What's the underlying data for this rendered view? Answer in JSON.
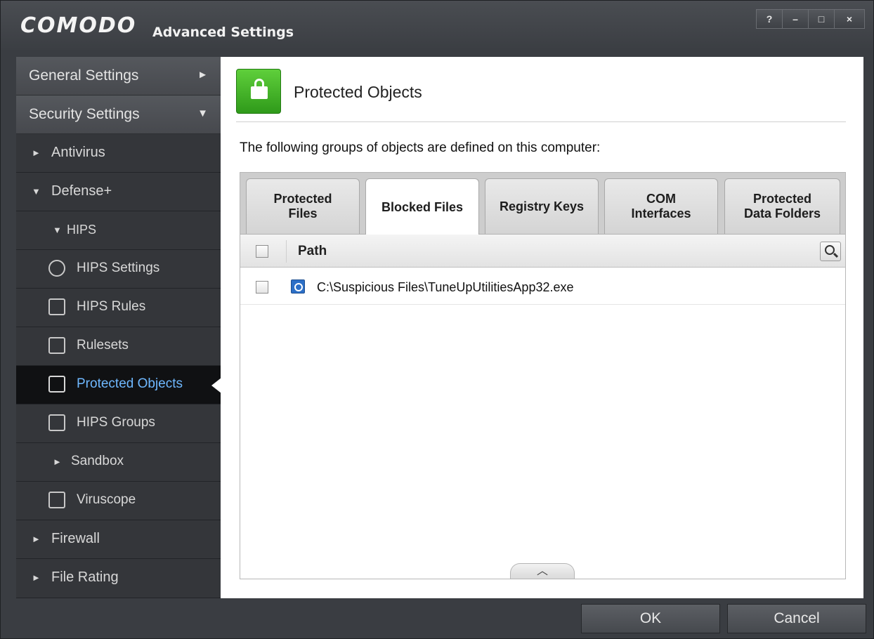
{
  "window": {
    "brand": "COMODO",
    "title": "Advanced Settings",
    "controls": {
      "help": "?",
      "minimize": "–",
      "maximize": "□",
      "close": "×"
    }
  },
  "sidebar": {
    "top_items": [
      {
        "label": "General Settings",
        "arrow": "►"
      },
      {
        "label": "Security Settings",
        "arrow": "▼"
      }
    ],
    "items": [
      {
        "label": "Antivirus",
        "marker": "►"
      },
      {
        "label": "Defense+",
        "marker": "▼"
      },
      {
        "label": "HIPS",
        "marker": "▼"
      },
      {
        "label": "HIPS Settings",
        "icon": "gear-icon"
      },
      {
        "label": "HIPS Rules",
        "icon": "rules-icon"
      },
      {
        "label": "Rulesets",
        "icon": "ruleset-icon"
      },
      {
        "label": "Protected Objects",
        "icon": "lock-icon",
        "active": true
      },
      {
        "label": "HIPS Groups",
        "icon": "groups-icon"
      },
      {
        "label": "Sandbox",
        "marker": "►"
      },
      {
        "label": "Viruscope",
        "icon": "viruscope-icon"
      },
      {
        "label": "Firewall",
        "marker": "►"
      },
      {
        "label": "File Rating",
        "marker": "►"
      }
    ]
  },
  "content": {
    "title": "Protected Objects",
    "description": "The following groups of objects are defined on this computer:",
    "tabs": [
      {
        "label": "Protected\nFiles"
      },
      {
        "label": "Blocked Files",
        "active": true
      },
      {
        "label": "Registry Keys"
      },
      {
        "label": "COM\nInterfaces"
      },
      {
        "label": "Protected\nData Folders"
      }
    ],
    "table": {
      "column_path": "Path",
      "rows": [
        {
          "path": "C:\\Suspicious Files\\TuneUpUtilitiesApp32.exe",
          "checked": false
        }
      ]
    },
    "collapse_glyph": "︿"
  },
  "footer": {
    "ok_label": "OK",
    "cancel_label": "Cancel"
  }
}
